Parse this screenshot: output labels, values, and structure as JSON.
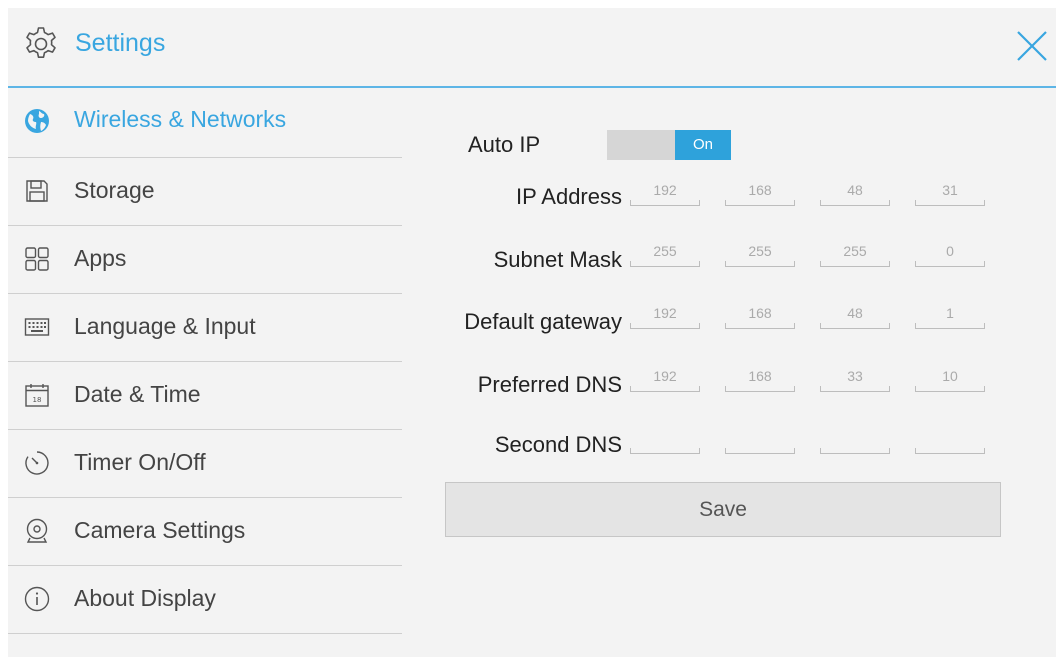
{
  "header": {
    "title": "Settings"
  },
  "sidebar": {
    "items": [
      {
        "label": "Wireless & Networks",
        "icon": "globe-icon",
        "active": true
      },
      {
        "label": "Storage",
        "icon": "storage-icon"
      },
      {
        "label": "Apps",
        "icon": "apps-grid-icon"
      },
      {
        "label": "Language & Input",
        "icon": "keyboard-icon"
      },
      {
        "label": "Date & Time",
        "icon": "calendar-icon"
      },
      {
        "label": "Timer On/Off",
        "icon": "timer-icon"
      },
      {
        "label": "Camera Settings",
        "icon": "camera-icon"
      },
      {
        "label": "About Display",
        "icon": "info-icon"
      }
    ]
  },
  "network": {
    "auto_ip_label": "Auto IP",
    "auto_ip_state": "On",
    "ip_address": {
      "label": "IP Address",
      "octets": [
        "192",
        "168",
        "48",
        "31"
      ]
    },
    "subnet_mask": {
      "label": "Subnet Mask",
      "octets": [
        "255",
        "255",
        "255",
        "0"
      ]
    },
    "default_gateway": {
      "label": "Default gateway",
      "octets": [
        "192",
        "168",
        "48",
        "1"
      ]
    },
    "preferred_dns": {
      "label": "Preferred DNS",
      "octets": [
        "192",
        "168",
        "33",
        "10"
      ]
    },
    "second_dns": {
      "label": "Second DNS",
      "octets": [
        "",
        "",
        "",
        ""
      ]
    },
    "save_label": "Save"
  },
  "colors": {
    "accent": "#39a6e0",
    "toggle_on": "#2ea2db",
    "background": "#f3f3f3"
  }
}
